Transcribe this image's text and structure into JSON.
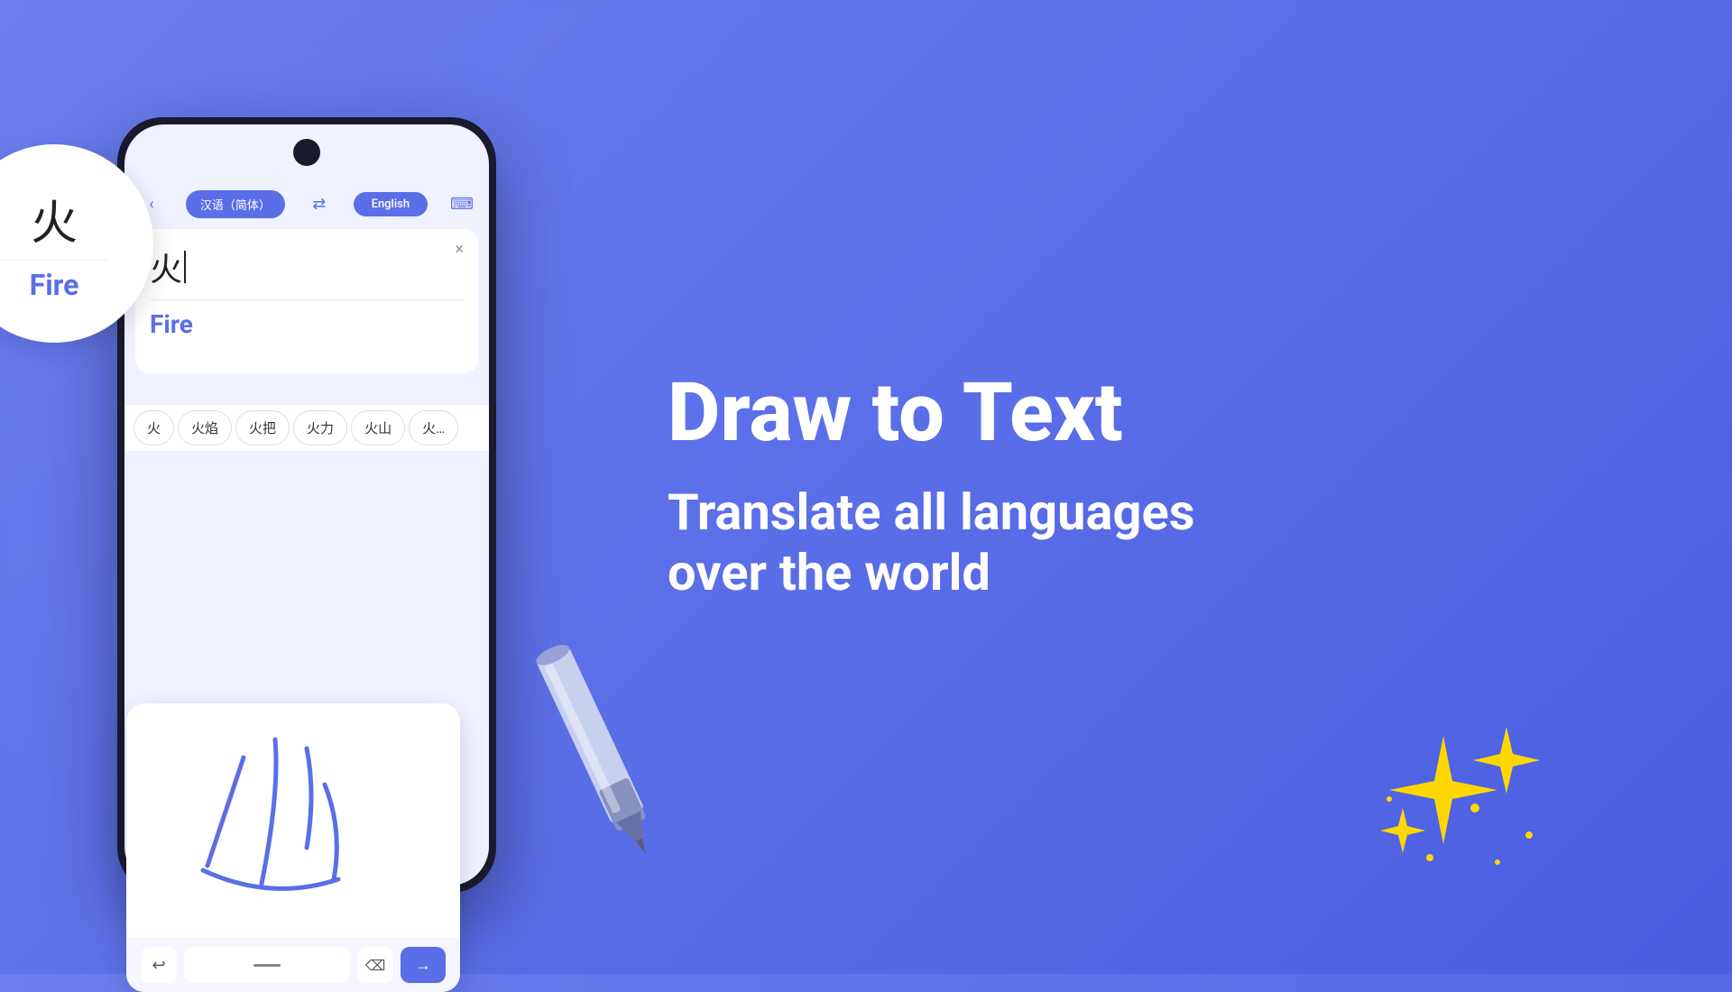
{
  "background": {
    "gradient_start": "#7b8ff5",
    "gradient_end": "#4a5de0"
  },
  "phone": {
    "source_lang": "汉语（简体）",
    "swap_icon": "⇄",
    "target_lang": "English",
    "keyboard_icon": "⌨",
    "back_icon": "‹",
    "close_icon": "×",
    "input_text": "火",
    "translation": "Fire",
    "suggestions": [
      "火",
      "火焰",
      "火把",
      "火力",
      "火山",
      "火..."
    ]
  },
  "callout": {
    "chinese": "火",
    "english": "Fire"
  },
  "handwriting_toolbar": {
    "undo_icon": "↩",
    "backspace_icon": "⌫",
    "enter_icon": "→"
  },
  "right": {
    "title": "Draw to Text",
    "subtitle_line1": "Translate all languages",
    "subtitle_line2": "over the world"
  }
}
